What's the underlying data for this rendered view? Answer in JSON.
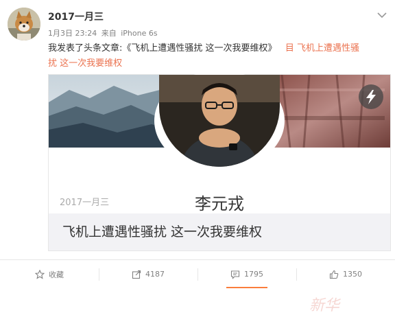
{
  "post": {
    "username": "2017一月三",
    "date": "1月3日 23:24",
    "source_prefix": "来自",
    "source": "iPhone 6s",
    "text_prefix": "我发表了头条文章:《飞机上遭遇性骚扰 这一次我要维权》",
    "link_text": "目 飞机上遭遇性骚",
    "link_text_2": "扰 这一次我要维权"
  },
  "card": {
    "author": "李元戎",
    "date": "2017一月三",
    "title": "飞机上遭遇性骚扰 这一次我要维权",
    "watermark": "新华"
  },
  "actions": [
    {
      "label": "收藏",
      "icon": "star-icon"
    },
    {
      "label": "4187",
      "icon": "share-icon"
    },
    {
      "label": "1795",
      "icon": "comment-icon"
    },
    {
      "label": "1350",
      "icon": "thumbs-up-icon"
    }
  ],
  "colors": {
    "link": "#eb7350",
    "accent": "#fa7d3c"
  }
}
